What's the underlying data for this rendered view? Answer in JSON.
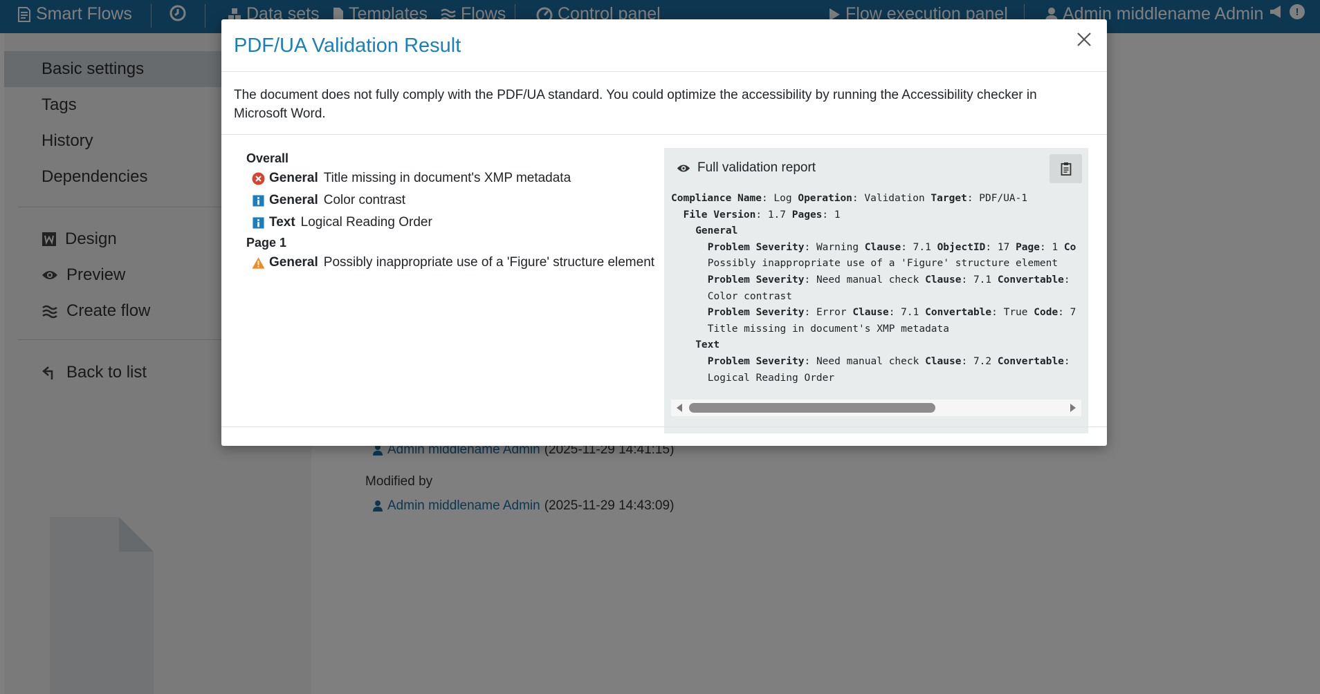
{
  "topbar": {
    "brand": "Smart Flows",
    "items": [
      "Data sets",
      "Templates",
      "Flows",
      "Control panel"
    ],
    "execution_panel": "Flow execution panel",
    "user": "Admin middlename Admin",
    "notification_count": "!"
  },
  "sidebar": {
    "items": [
      "Basic settings",
      "Tags",
      "History",
      "Dependencies"
    ],
    "actions": [
      "Design",
      "Preview",
      "Create flow"
    ],
    "back": "Back to list"
  },
  "main": {
    "created_user": "Admin middlename Admin",
    "created_ts": "(2025-11-29 14:41:15)",
    "modified_label": "Modified by",
    "modified_user": "Admin middlename Admin",
    "modified_ts": "(2025-11-29 14:43:09)"
  },
  "modal": {
    "title": "PDF/UA Validation Result",
    "intro": "The document does not fully comply with the PDF/UA standard. You could optimize the accessibility by running the Accessibility checker in Microsoft Word.",
    "groups": [
      {
        "title": "Overall",
        "issues": [
          {
            "icon": "error-icon",
            "category": "General",
            "message": "Title missing in document's XMP metadata"
          },
          {
            "icon": "info-icon",
            "category": "General",
            "message": "Color contrast"
          },
          {
            "icon": "info-icon",
            "category": "Text",
            "message": "Logical Reading Order"
          }
        ]
      },
      {
        "title": "Page 1",
        "issues": [
          {
            "icon": "warning-icon",
            "category": "General",
            "message": "Possibly inappropriate use of a 'Figure' structure element"
          }
        ]
      }
    ],
    "report": {
      "heading": "Full validation report",
      "lines": [
        {
          "indent": 0,
          "parts": [
            [
              "Compliance Name",
              ": Log "
            ],
            [
              "Operation",
              ": Validation "
            ],
            [
              "Target",
              ": PDF/UA-1"
            ]
          ]
        },
        {
          "indent": 1,
          "parts": [
            [
              "File Version",
              ": 1.7 "
            ],
            [
              "Pages",
              ": 1"
            ]
          ]
        },
        {
          "indent": 2,
          "parts": [
            [
              "General",
              ""
            ]
          ]
        },
        {
          "indent": 3,
          "parts": [
            [
              "Problem Severity",
              ": Warning "
            ],
            [
              "Clause",
              ": 7.1 "
            ],
            [
              "ObjectID",
              ": 17 "
            ],
            [
              "Page",
              ": 1 "
            ],
            [
              "Co",
              ""
            ]
          ]
        },
        {
          "indent": 3,
          "parts": [
            [
              "",
              "Possibly inappropriate use of a 'Figure' structure element"
            ]
          ]
        },
        {
          "indent": 3,
          "parts": [
            [
              "Problem Severity",
              ": Need manual check "
            ],
            [
              "Clause",
              ": 7.1 "
            ],
            [
              "Convertable",
              ":"
            ]
          ]
        },
        {
          "indent": 3,
          "parts": [
            [
              "",
              "Color contrast"
            ]
          ]
        },
        {
          "indent": 3,
          "parts": [
            [
              "Problem Severity",
              ": Error "
            ],
            [
              "Clause",
              ": 7.1 "
            ],
            [
              "Convertable",
              ": True "
            ],
            [
              "Code",
              ": 7"
            ]
          ]
        },
        {
          "indent": 3,
          "parts": [
            [
              "",
              "Title missing in document's XMP metadata"
            ]
          ]
        },
        {
          "indent": 2,
          "parts": [
            [
              "Text",
              ""
            ]
          ]
        },
        {
          "indent": 3,
          "parts": [
            [
              "Problem Severity",
              ": Need manual check "
            ],
            [
              "Clause",
              ": 7.2 "
            ],
            [
              "Convertable",
              ":"
            ]
          ]
        },
        {
          "indent": 3,
          "parts": [
            [
              "",
              "Logical Reading Order"
            ]
          ]
        }
      ]
    }
  },
  "colors": {
    "topbar": "#1a6fa3",
    "title": "#1a7fbf",
    "error": "#d9432b",
    "info": "#1a7fbf",
    "warning": "#f08a24"
  }
}
